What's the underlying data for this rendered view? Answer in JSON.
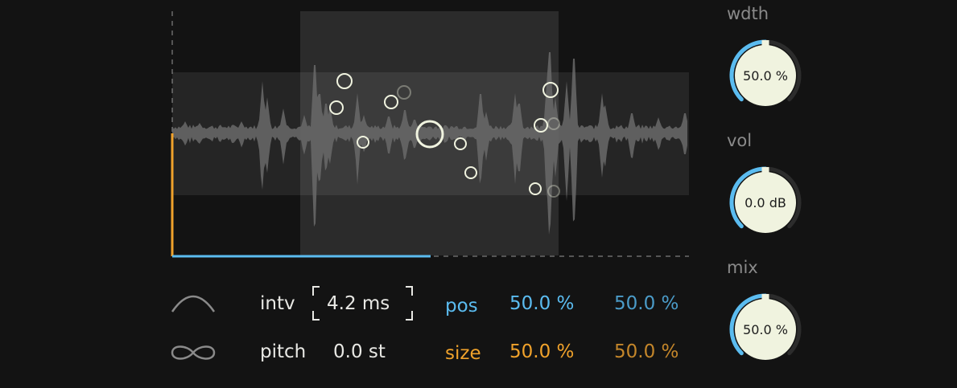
{
  "plot": {
    "window": {
      "position": 0.5,
      "size": 0.5
    },
    "grain_vertical_range": {
      "top": 0.25,
      "bottom": 0.75
    },
    "progress": {
      "blue": 0.5,
      "orange_level": 0.5
    }
  },
  "controls": {
    "interval": {
      "label": "intv",
      "value": "4.2 ms"
    },
    "pitch": {
      "label": "pitch",
      "value": "0.0 st"
    },
    "position": {
      "label": "pos",
      "value_a": "50.0 %",
      "value_b": "50.0 %"
    },
    "size": {
      "label": "size",
      "value_a": "50.0 %",
      "value_b": "50.0 %"
    }
  },
  "icons": {
    "envelope": "envelope-curve-icon",
    "loop": "infinity-loop-icon"
  },
  "knobs": [
    {
      "id": "wdth",
      "label": "wdth",
      "value": "50.0 %",
      "level": 0.5
    },
    {
      "id": "vol",
      "label": "vol",
      "value": "0.0 dB",
      "level": 0.5
    },
    {
      "id": "mix",
      "label": "mix",
      "value": "50.0 %",
      "level": 0.5
    }
  ],
  "colors": {
    "background": "#131313",
    "accent_blue": "#5bbcf0",
    "accent_orange": "#f0a22b",
    "knob_face": "#f0f3df",
    "text_light": "#e8e8e4"
  }
}
